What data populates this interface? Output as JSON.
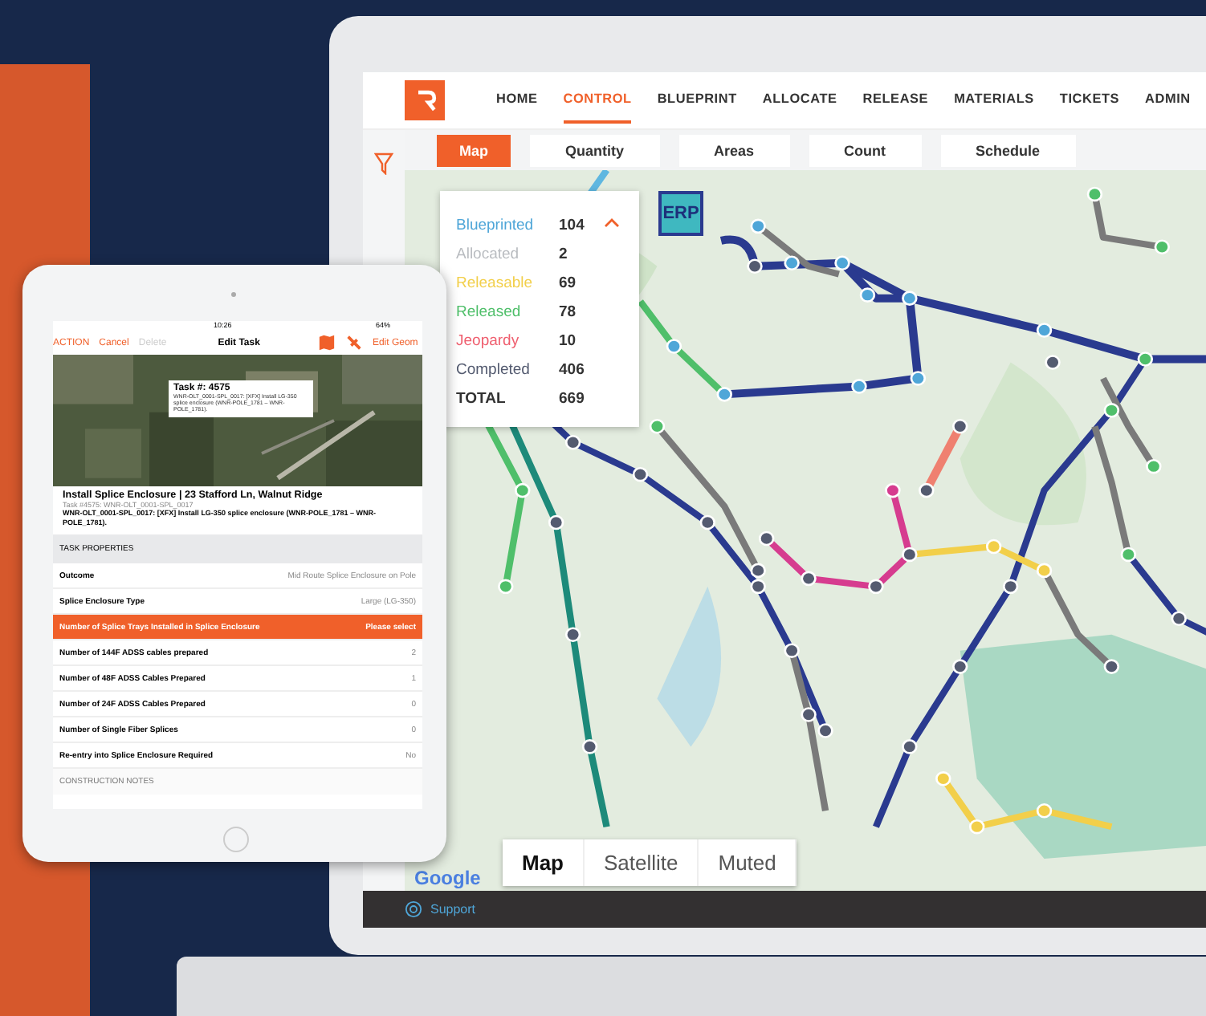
{
  "laptop": {
    "nav": [
      {
        "label": "HOME",
        "selected": false
      },
      {
        "label": "CONTROL",
        "selected": true
      },
      {
        "label": "BLUEPRINT",
        "selected": false
      },
      {
        "label": "ALLOCATE",
        "selected": false
      },
      {
        "label": "RELEASE",
        "selected": false
      },
      {
        "label": "MATERIALS",
        "selected": false
      },
      {
        "label": "TICKETS",
        "selected": false
      },
      {
        "label": "ADMIN",
        "selected": false
      }
    ],
    "subtabs": [
      {
        "label": "Map",
        "selected": true
      },
      {
        "label": "Quantity",
        "selected": false
      },
      {
        "label": "Areas",
        "selected": false
      },
      {
        "label": "Count",
        "selected": false
      },
      {
        "label": "Schedule",
        "selected": false
      }
    ],
    "legend": {
      "expanded": true,
      "items": [
        {
          "label": "Blueprinted",
          "count": "104",
          "color": "#4fa6d8"
        },
        {
          "label": "Allocated",
          "count": "2",
          "color": "#b9bcc0"
        },
        {
          "label": "Releasable",
          "count": "69",
          "color": "#f2cf4a"
        },
        {
          "label": "Released",
          "count": "78",
          "color": "#4fbf6a"
        },
        {
          "label": "Jeopardy",
          "count": "10",
          "color": "#ef5f6f"
        },
        {
          "label": "Completed",
          "count": "406",
          "color": "#545b70"
        }
      ],
      "total_label": "TOTAL",
      "total": "669"
    },
    "map": {
      "marker": "ERP",
      "attribution": "Google",
      "map_types": [
        {
          "label": "Map",
          "selected": true
        },
        {
          "label": "Satellite",
          "selected": false
        },
        {
          "label": "Muted",
          "selected": false
        }
      ]
    },
    "footer": {
      "link": "Support"
    }
  },
  "tablet": {
    "status": {
      "time": "10:26",
      "battery": "64%"
    },
    "toolbar": {
      "action": "ACTION",
      "cancel": "Cancel",
      "delete": {
        "label": "Delete",
        "disabled": true
      },
      "title": "Edit Task",
      "edit": "Edit Geom"
    },
    "map_popup": {
      "title": "Task #: 4575",
      "text": "WNR-OLT_0001-SPL_0017: [XFX] Install LG-350 splice enclosure (WNR-POLE_1781 – WNR-POLE_1781)."
    },
    "task": {
      "title": "Install Splice Enclosure | 23 Stafford Ln, Walnut Ridge",
      "subtitle": "Task #4575: WNR-OLT_0001-SPL_0017",
      "description": "WNR-OLT_0001-SPL_0017: [XFX] Install LG-350 splice enclosure (WNR-POLE_1781 – WNR-POLE_1781)."
    },
    "section": "TASK PROPERTIES",
    "properties": [
      {
        "label": "Outcome",
        "value": "Mid Route Splice Enclosure on Pole",
        "highlighted": false
      },
      {
        "label": "Splice Enclosure Type",
        "value": "Large (LG-350)",
        "highlighted": false
      },
      {
        "label": "Number of Splice Trays Installed in Splice Enclosure",
        "value": "Please select",
        "highlighted": true
      },
      {
        "label": "Number of 144F ADSS cables prepared",
        "value": "2",
        "highlighted": false
      },
      {
        "label": "Number of 48F ADSS Cables Prepared",
        "value": "1",
        "highlighted": false
      },
      {
        "label": "Number of 24F ADSS Cables Prepared",
        "value": "0",
        "highlighted": false
      },
      {
        "label": "Number of Single Fiber Splices",
        "value": "0",
        "highlighted": false
      },
      {
        "label": "Re-entry into Splice Enclosure Required",
        "value": "No",
        "highlighted": false
      }
    ],
    "notes_header": "CONSTRUCTION NOTES"
  }
}
